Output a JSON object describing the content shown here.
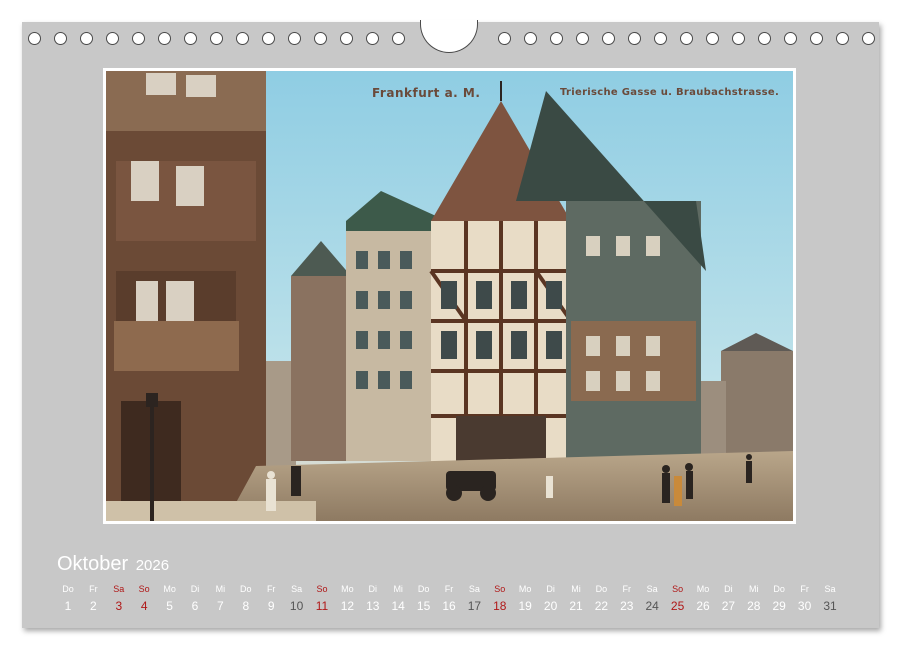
{
  "photo": {
    "caption_left": "Frankfurt a. M.",
    "caption_right": "Trierische Gasse u. Braubachstrasse."
  },
  "calendar": {
    "month": "Oktober",
    "year": "2026",
    "days": [
      {
        "name": "Do",
        "num": "1",
        "type": "weekday"
      },
      {
        "name": "Fr",
        "num": "2",
        "type": "weekday"
      },
      {
        "name": "Sa",
        "num": "3",
        "type": "holiday"
      },
      {
        "name": "So",
        "num": "4",
        "type": "sunday"
      },
      {
        "name": "Mo",
        "num": "5",
        "type": "weekday"
      },
      {
        "name": "Di",
        "num": "6",
        "type": "weekday"
      },
      {
        "name": "Mi",
        "num": "7",
        "type": "weekday"
      },
      {
        "name": "Do",
        "num": "8",
        "type": "weekday"
      },
      {
        "name": "Fr",
        "num": "9",
        "type": "weekday"
      },
      {
        "name": "Sa",
        "num": "10",
        "type": "saturday"
      },
      {
        "name": "So",
        "num": "11",
        "type": "sunday"
      },
      {
        "name": "Mo",
        "num": "12",
        "type": "weekday"
      },
      {
        "name": "Di",
        "num": "13",
        "type": "weekday"
      },
      {
        "name": "Mi",
        "num": "14",
        "type": "weekday"
      },
      {
        "name": "Do",
        "num": "15",
        "type": "weekday"
      },
      {
        "name": "Fr",
        "num": "16",
        "type": "weekday"
      },
      {
        "name": "Sa",
        "num": "17",
        "type": "saturday"
      },
      {
        "name": "So",
        "num": "18",
        "type": "sunday"
      },
      {
        "name": "Mo",
        "num": "19",
        "type": "weekday"
      },
      {
        "name": "Di",
        "num": "20",
        "type": "weekday"
      },
      {
        "name": "Mi",
        "num": "21",
        "type": "weekday"
      },
      {
        "name": "Do",
        "num": "22",
        "type": "weekday"
      },
      {
        "name": "Fr",
        "num": "23",
        "type": "weekday"
      },
      {
        "name": "Sa",
        "num": "24",
        "type": "saturday"
      },
      {
        "name": "So",
        "num": "25",
        "type": "sunday"
      },
      {
        "name": "Mo",
        "num": "26",
        "type": "weekday"
      },
      {
        "name": "Di",
        "num": "27",
        "type": "weekday"
      },
      {
        "name": "Mi",
        "num": "28",
        "type": "weekday"
      },
      {
        "name": "Do",
        "num": "29",
        "type": "weekday"
      },
      {
        "name": "Fr",
        "num": "30",
        "type": "weekday"
      },
      {
        "name": "Sa",
        "num": "31",
        "type": "saturday"
      }
    ]
  },
  "colors": {
    "page": "#c8c8c8",
    "sunday": "#b01818",
    "saturday_number": "#555555",
    "text": "#ffffff"
  }
}
